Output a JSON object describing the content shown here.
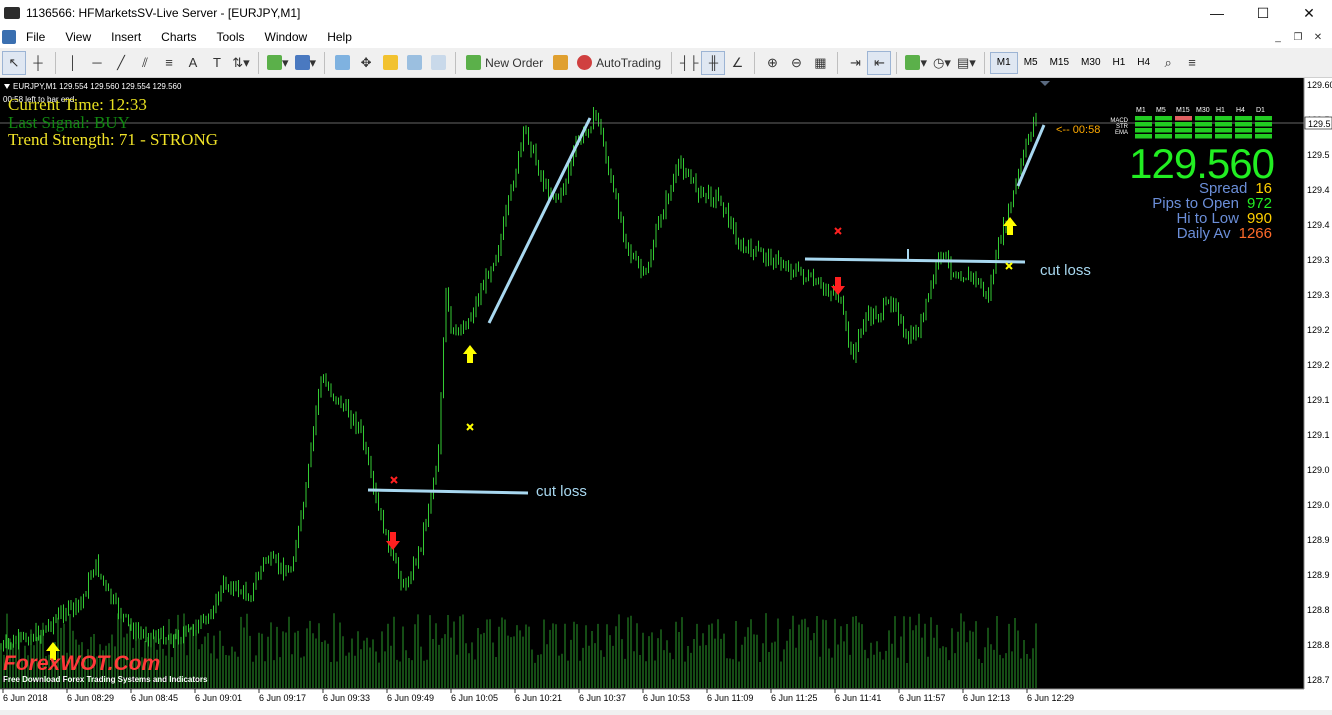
{
  "window": {
    "title": "1136566: HFMarketsSV-Live Server - [EURJPY,M1]",
    "buttons": {
      "minimize": "—",
      "maximize": "☐",
      "close": "✕"
    }
  },
  "menu": {
    "items": [
      "File",
      "View",
      "Insert",
      "Charts",
      "Tools",
      "Window",
      "Help"
    ],
    "mdi_buttons": [
      "_",
      "❐",
      "✕"
    ]
  },
  "toolbar": {
    "new_order": "New Order",
    "autotrading": "AutoTrading",
    "timeframes": [
      "M1",
      "M5",
      "M15",
      "M30",
      "H1",
      "H4"
    ],
    "active_timeframe": "M1"
  },
  "chart": {
    "info_line": "EURJPY,M1  129.554 129.560 129.554 129.560",
    "bar_timer": "00:58 left to bar end",
    "overlay": {
      "current_time": "Current Time: 12:33",
      "last_signal": "Last Signal: BUY",
      "trend_strength": "Trend Strength: 71 - STRONG"
    },
    "countdown": "<-- 00:58",
    "price_axis": [
      "129.605",
      "129.5",
      "129.5",
      "129.4",
      "129.4",
      "129.3",
      "129.3",
      "129.2",
      "129.2",
      "129.1",
      "129.1",
      "129.0",
      "129.0",
      "128.9",
      "128.9",
      "128.8",
      "128.8",
      "128.7"
    ],
    "time_axis": [
      "6 Jun 2018",
      "6 Jun 08:29",
      "6 Jun 08:45",
      "6 Jun 09:01",
      "6 Jun 09:17",
      "6 Jun 09:33",
      "6 Jun 09:49",
      "6 Jun 10:05",
      "6 Jun 10:21",
      "6 Jun 10:37",
      "6 Jun 10:53",
      "6 Jun 11:09",
      "6 Jun 11:25",
      "6 Jun 11:41",
      "6 Jun 11:57",
      "6 Jun 12:13",
      "6 Jun 12:29"
    ],
    "current_price_label": "129.5",
    "annotations": {
      "cut_loss_1": "cut loss",
      "cut_loss_2": "cut loss"
    },
    "colors": {
      "bull": "#33cc33",
      "up_arrow": "#ffff00",
      "down_arrow": "#ff2020",
      "cross_red": "#ff2020",
      "cross_yellow": "#ffff00",
      "line": "#a8d8f0"
    }
  },
  "panel": {
    "indicator_tfs": [
      "M1",
      "M5",
      "M15",
      "M30",
      "H1",
      "H4",
      "D1"
    ],
    "indicator_rows": [
      "MACD",
      "STR",
      "EMA"
    ],
    "price": "129.560",
    "stats": [
      {
        "key": "Spread",
        "value": "16",
        "color": "#ffd000"
      },
      {
        "key": "Pips to Open",
        "value": "972",
        "color": "#22ee22"
      },
      {
        "key": "Hi to Low",
        "value": "990",
        "color": "#ffd000"
      },
      {
        "key": "Daily Av",
        "value": "1266",
        "color": "#ff6a2a"
      }
    ]
  },
  "watermark": {
    "brand": "ForexWOT.Com",
    "tagline": "Free Download Forex Trading Systems and Indicators"
  }
}
